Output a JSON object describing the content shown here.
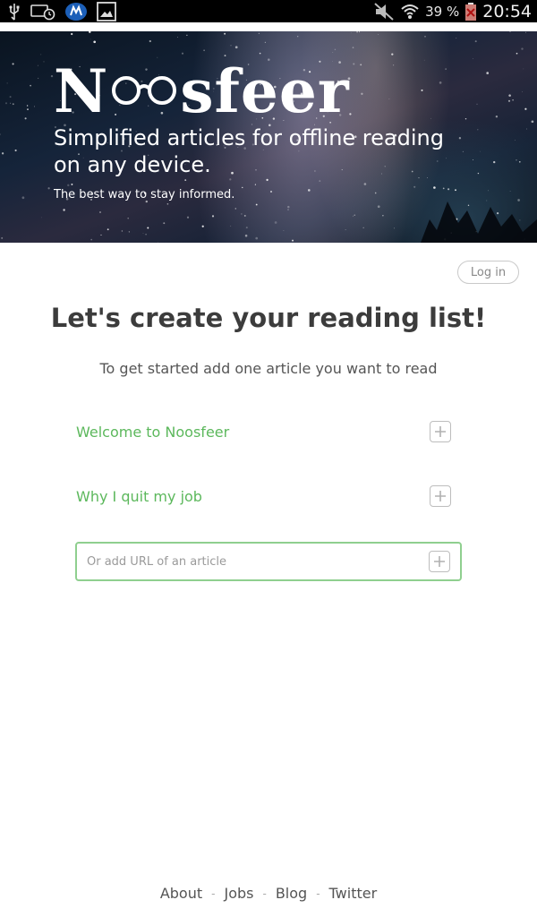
{
  "status_bar": {
    "icons_left": [
      "usb-icon",
      "alarm-clock-icon",
      "vpn-shield-icon",
      "image-icon"
    ],
    "icons_right": [
      "mute-icon",
      "wifi-icon"
    ],
    "battery_percent": "39 %",
    "battery_icon": "battery-low-icon",
    "time": "20:54"
  },
  "hero": {
    "logo": "Noosfeer",
    "logo_parts": [
      "N",
      "sfeer"
    ],
    "tagline": "Simplified articles for offline reading on any device.",
    "subtitle": "The best way to stay informed."
  },
  "login": {
    "label": "Log in"
  },
  "main": {
    "heading": "Let's create your reading list!",
    "subheading": "To get started add one article you want to read",
    "suggested_articles": [
      {
        "title": "Welcome to Noosfeer",
        "action_icon": "plus-icon"
      },
      {
        "title": "Why I quit my job",
        "action_icon": "plus-icon"
      }
    ],
    "url_input": {
      "value": "",
      "placeholder": "Or add URL of an article",
      "action_icon": "plus-icon"
    }
  },
  "footer": {
    "links": [
      "About",
      "Jobs",
      "Blog",
      "Twitter"
    ],
    "separator": "-"
  },
  "colors": {
    "accent_green": "#5cb85c",
    "input_border": "#8fcf8f",
    "heading_text": "#3c3c3c",
    "status_bar_bg": "#000000"
  }
}
